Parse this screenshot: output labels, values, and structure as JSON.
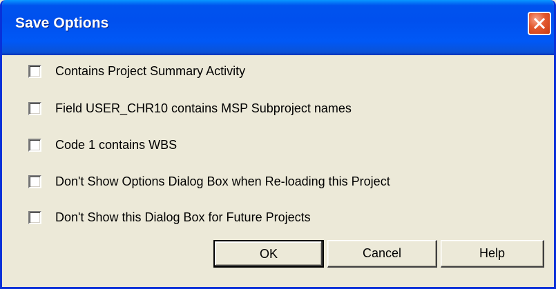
{
  "window": {
    "title": "Save Options"
  },
  "options": [
    {
      "label": "Contains Project Summary Activity",
      "checked": false
    },
    {
      "label": "Field USER_CHR10 contains MSP Subproject names",
      "checked": false
    },
    {
      "label": "Code 1 contains WBS",
      "checked": false
    },
    {
      "label": "Don't Show Options Dialog Box when Re-loading this Project",
      "checked": false
    },
    {
      "label": "Don't Show this Dialog Box for Future Projects",
      "checked": false
    }
  ],
  "buttons": {
    "ok_label": "OK",
    "cancel_label": "Cancel",
    "help_label": "Help"
  },
  "icons": {
    "close": "close-icon"
  },
  "colors": {
    "titlebar": "#0054e3",
    "dialog_background": "#ece9d8",
    "close_button": "#e3582e"
  }
}
